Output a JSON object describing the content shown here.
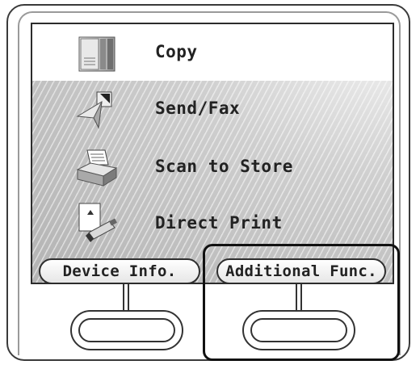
{
  "menu": {
    "items": [
      {
        "label": "Copy",
        "icon": "copy-icon"
      },
      {
        "label": "Send/Fax",
        "icon": "send-fax-icon"
      },
      {
        "label": "Scan to Store",
        "icon": "scan-to-store-icon"
      },
      {
        "label": "Direct Print",
        "icon": "direct-print-icon"
      }
    ],
    "selected": "Copy"
  },
  "tabs": {
    "device_info": "Device Info.",
    "additional_func": "Additional Func."
  },
  "colors": {
    "frame": "#3a3a3a",
    "selected_row": "#ffffff",
    "background": "#bdbdbd"
  }
}
